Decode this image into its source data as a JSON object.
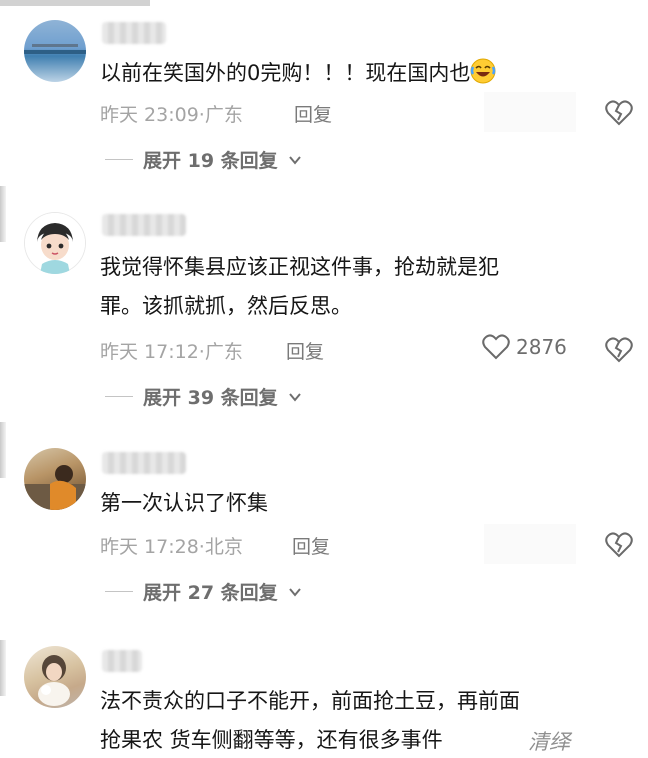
{
  "comments": [
    {
      "text_lines": [
        "以前在笑国外的0完购！！！现在国内也"
      ],
      "time": "昨天 23:09",
      "location": "广东",
      "reply_label": "回复",
      "likes": "",
      "expand_label": "展开 19 条回复"
    },
    {
      "text_lines": [
        "我觉得怀集县应该正视这件事，抢劫就是犯",
        "罪。该抓就抓，然后反思。"
      ],
      "time": "昨天 17:12",
      "location": "广东",
      "reply_label": "回复",
      "likes": "2876",
      "expand_label": "展开 39 条回复"
    },
    {
      "text_lines": [
        "第一次认识了怀集"
      ],
      "time": "昨天 17:28",
      "location": "北京",
      "reply_label": "回复",
      "likes": "",
      "expand_label": "展开 27 条回复"
    },
    {
      "text_lines": [
        "法不责众的口子不能开，前面抢土豆，再前面",
        "抢果农 货车侧翻等等，还有很多事件"
      ],
      "overlay": "清绎",
      "time": "",
      "location": "",
      "reply_label": "",
      "likes": "",
      "expand_label": ""
    }
  ],
  "icons": {
    "dislike": "broken-heart-icon",
    "like": "heart-outline-icon",
    "expand": "chevron-down-icon",
    "emoji": "laughing-tears-emoji-icon"
  },
  "colors": {
    "text": "#161616",
    "meta": "#a4a4a4",
    "secondary": "#6e6e6e"
  }
}
